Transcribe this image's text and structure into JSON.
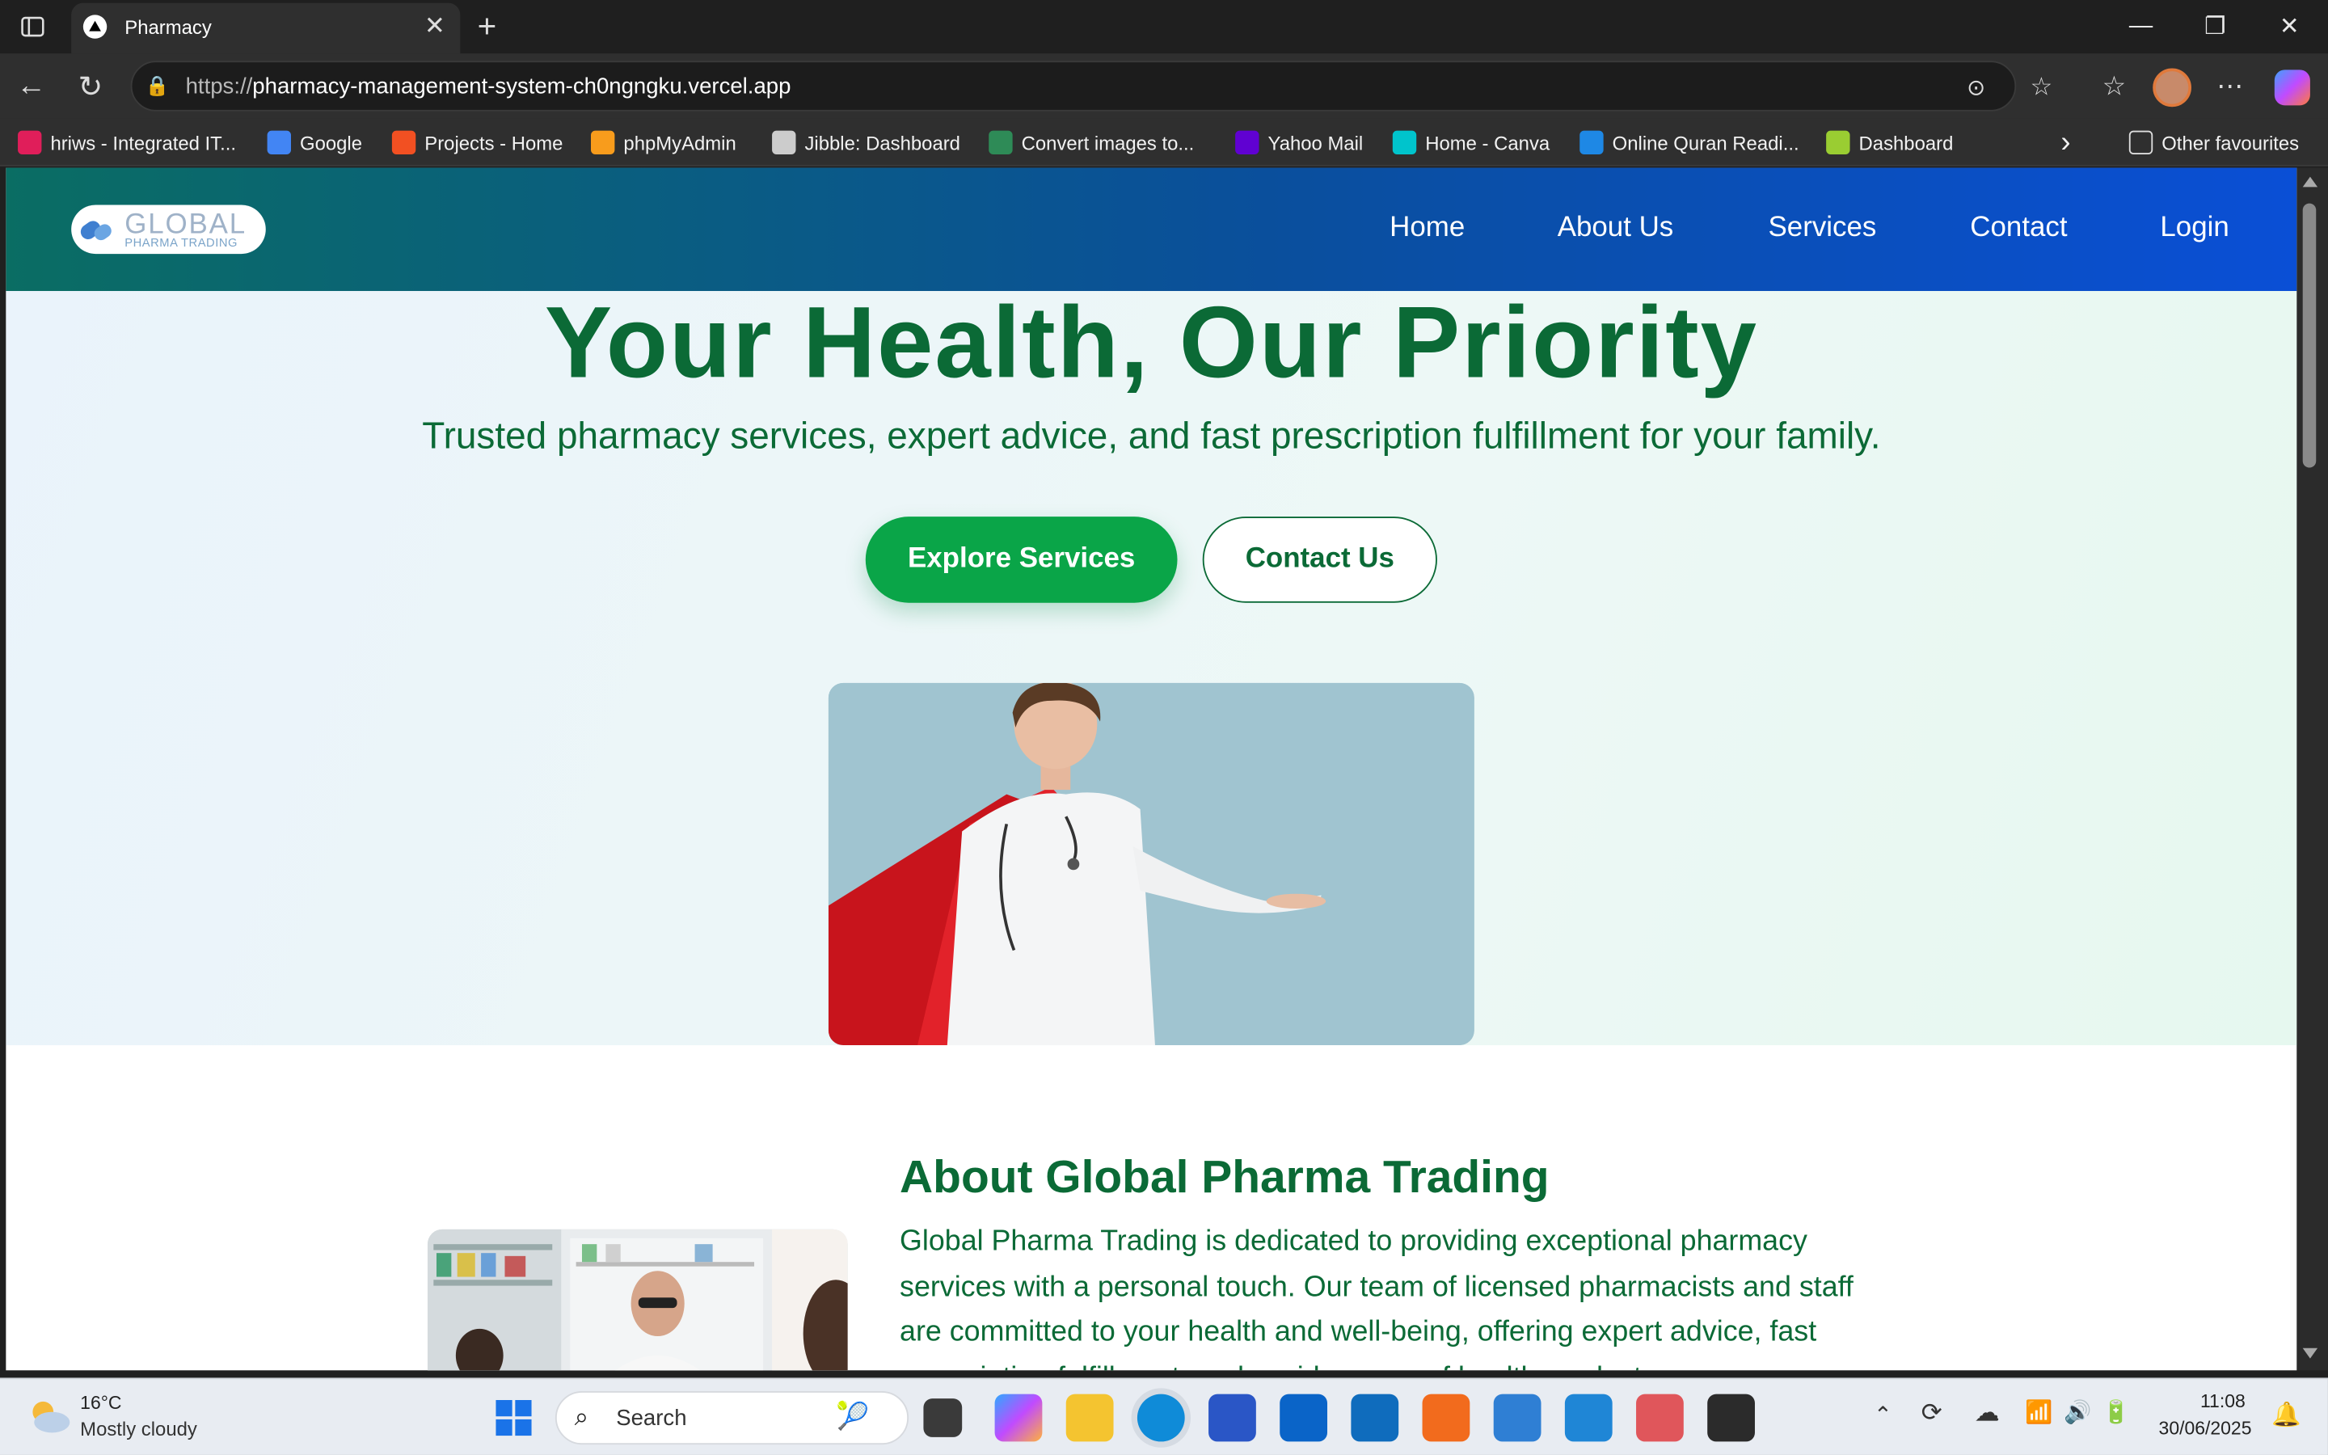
{
  "browser": {
    "tab_title": "Pharmacy",
    "url_prefix": "https://",
    "url_host": "pharmacy-management-system-ch0ngngku.vercel.app",
    "bookmarks": [
      {
        "label": "hriws - Integrated IT...",
        "color": "#e01e5a"
      },
      {
        "label": "Google",
        "color": "#4285f4"
      },
      {
        "label": "Projects - Home",
        "color": "#f25022"
      },
      {
        "label": "phpMyAdmin",
        "color": "#f89c1c"
      },
      {
        "label": "Jibble: Dashboard",
        "color": "#cccccc"
      },
      {
        "label": "Convert images to...",
        "color": "#2e8b57"
      },
      {
        "label": "Yahoo Mail",
        "color": "#6001d2"
      },
      {
        "label": "Home - Canva",
        "color": "#00c4cc"
      },
      {
        "label": "Online Quran Readi...",
        "color": "#1e88e5"
      },
      {
        "label": "Dashboard",
        "color": "#9acd32"
      }
    ],
    "other_favourites": "Other favourites"
  },
  "site": {
    "logo_main": "GLOBAL",
    "logo_sub": "PHARMA TRADING",
    "nav": [
      "Home",
      "About Us",
      "Services",
      "Contact",
      "Login"
    ],
    "hero_title": "Your Health, Our Priority",
    "hero_subtitle": "Trusted pharmacy services, expert advice, and fast prescription fulfillment for your family.",
    "btn_explore": "Explore Services",
    "btn_contact": "Contact Us",
    "about_title": "About Global Pharma Trading",
    "about_text": "Global Pharma Trading is dedicated to providing exceptional pharmacy services with a personal touch. Our team of licensed pharmacists and staff are committed to your health and well-being, offering expert advice, fast prescription fulfillment, and a wide range of health products."
  },
  "taskbar": {
    "temp": "16°C",
    "weather": "Mostly cloudy",
    "search": "Search",
    "time": "11:08",
    "date": "30/06/2025"
  }
}
